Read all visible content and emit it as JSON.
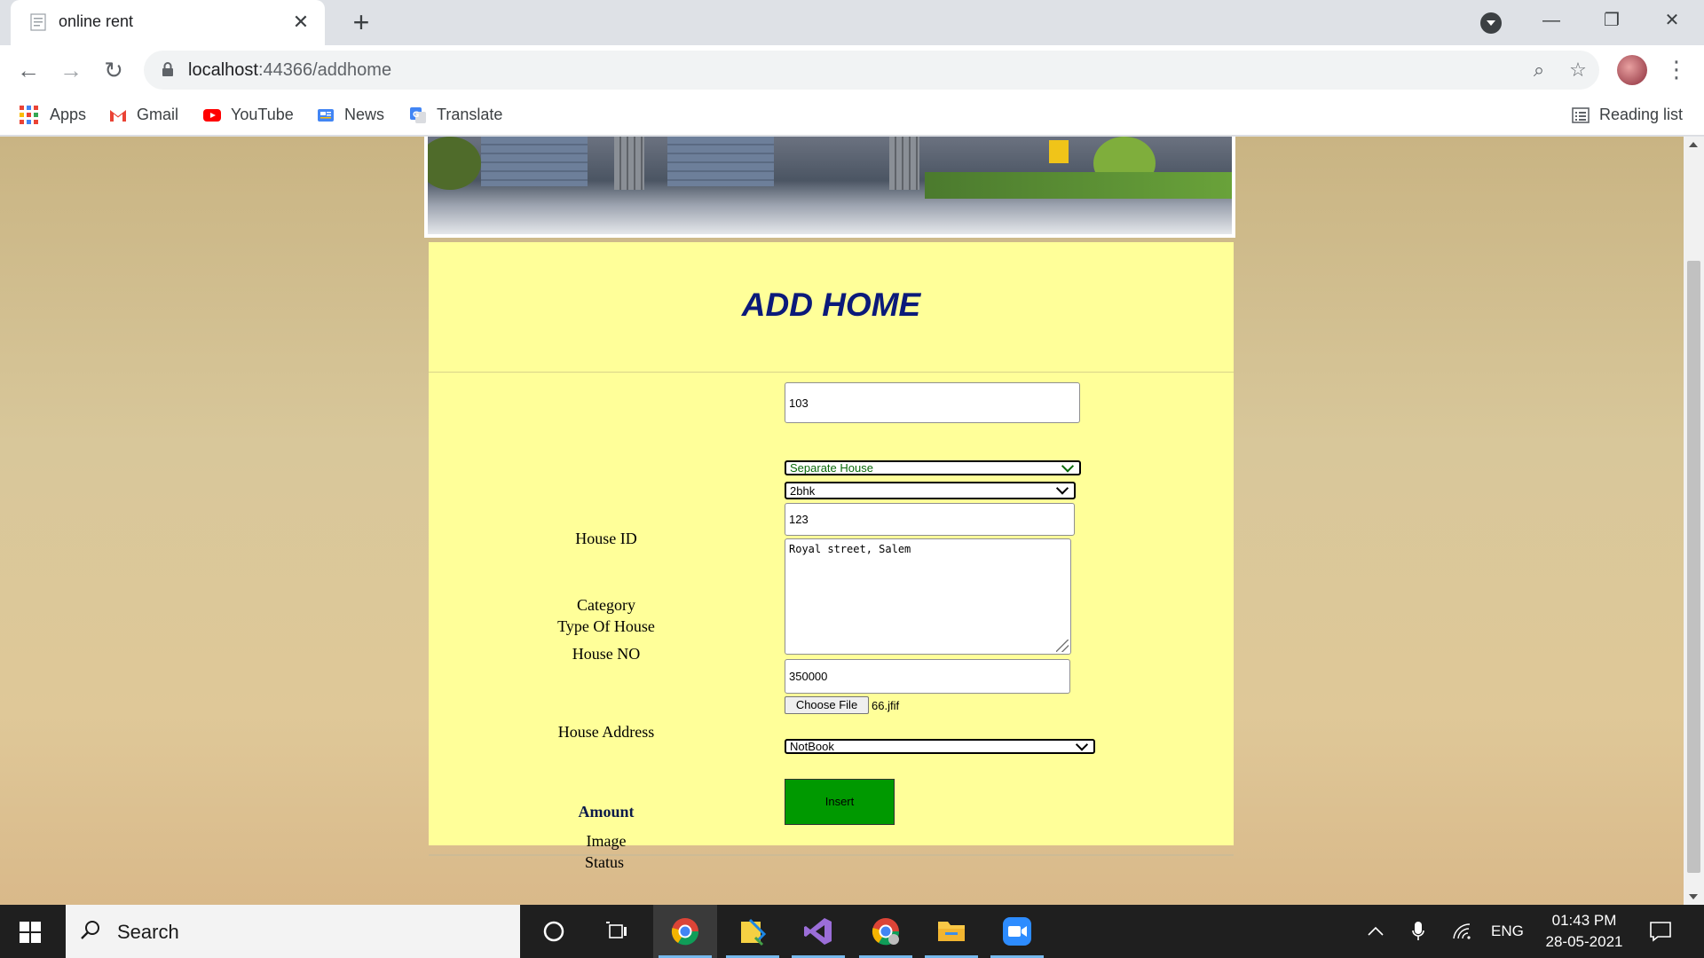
{
  "browser": {
    "tab_title": "online rent",
    "url_host": "localhost",
    "url_rest": ":44366/addhome",
    "bookmarks": {
      "apps": "Apps",
      "gmail": "Gmail",
      "youtube": "YouTube",
      "news": "News",
      "translate": "Translate",
      "reading_list": "Reading list"
    }
  },
  "page": {
    "heading": "ADD HOME",
    "labels": {
      "house_id": "House ID",
      "category": "Category",
      "type_of_house": "Type Of House",
      "house_no": "House NO",
      "house_address": "House Address",
      "amount": "Amount",
      "image": "Image",
      "status": "Status"
    },
    "values": {
      "house_id": "103",
      "category": "Separate House",
      "type_of_house": "2bhk",
      "house_no": "123",
      "house_address": "Royal street, Salem",
      "amount": "350000",
      "image_file": "66.jfif",
      "status": "NotBook"
    },
    "buttons": {
      "choose_file": "Choose File",
      "insert": "Insert"
    },
    "colors": {
      "panel_bg": "#ffff99",
      "heading": "#0b1a7a",
      "insert_bg": "#009900"
    }
  },
  "taskbar": {
    "search_placeholder": "Search",
    "language": "ENG",
    "time": "01:43 PM",
    "date": "28-05-2021"
  }
}
